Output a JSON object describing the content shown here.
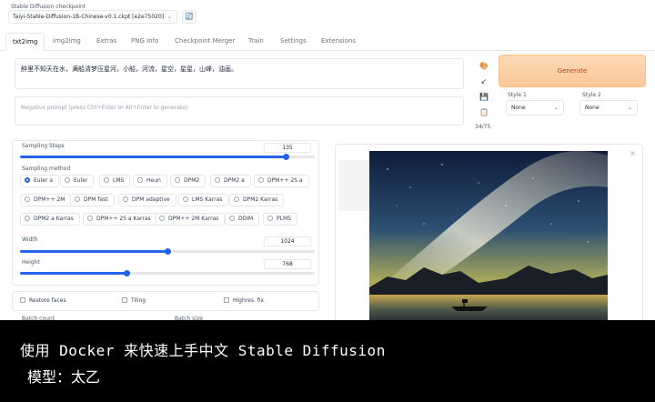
{
  "checkpoint": {
    "label": "Stable Diffusion checkpoint",
    "value": "Taiyi-Stable-Diffusion-1B-Chinese-v0.1.ckpt [e2e75020]",
    "refresh_icon": "refresh-icon"
  },
  "tabs": [
    "txt2img",
    "img2img",
    "Extras",
    "PNG Info",
    "Checkpoint Merger",
    "Train",
    "Settings",
    "Extensions"
  ],
  "prompt": {
    "value": "醉里不知天在水，满船清梦压星河，小船，河流，星空，星星，山峰，油画。",
    "negative_placeholder": "Negative prompt (press Ctrl+Enter or Alt+Enter to generate)",
    "token_count": "34/75"
  },
  "side_icons": [
    "paint-palette-icon",
    "arrow-down-left-icon",
    "save-icon",
    "clipboard-icon"
  ],
  "generate": {
    "label": "Generate"
  },
  "styles": [
    {
      "label": "Style 1",
      "value": "None"
    },
    {
      "label": "Style 2",
      "value": "None"
    }
  ],
  "sampling_steps": {
    "label": "Sampling Steps",
    "value": "135",
    "fraction": 0.9
  },
  "sampling_method": {
    "label": "Sampling method",
    "options": [
      "Euler a",
      "Euler",
      "LMS",
      "Heun",
      "DPM2",
      "DPM2 a",
      "DPM++ 2S a",
      "DPM++ 2M",
      "DPM fast",
      "DPM adaptive",
      "LMS Karras",
      "DPM2 Karras",
      "DPM2 a Karras",
      "DPM++ 2S a Karras",
      "DPM++ 2M Karras",
      "DDIM",
      "PLMS"
    ],
    "selected": "Euler a"
  },
  "width": {
    "label": "Width",
    "value": "1024",
    "fraction": 0.5
  },
  "height": {
    "label": "Height",
    "value": "768",
    "fraction": 0.36
  },
  "checks": [
    "Restore faces",
    "Tiling",
    "Highres. fix"
  ],
  "batch": {
    "count_label": "Batch count",
    "size_label": "Batch size"
  },
  "close_icon": "close-icon",
  "caption": {
    "line1": "使用 Docker 来快速上手中文 Stable Diffusion",
    "line2": "模型：太乙"
  }
}
